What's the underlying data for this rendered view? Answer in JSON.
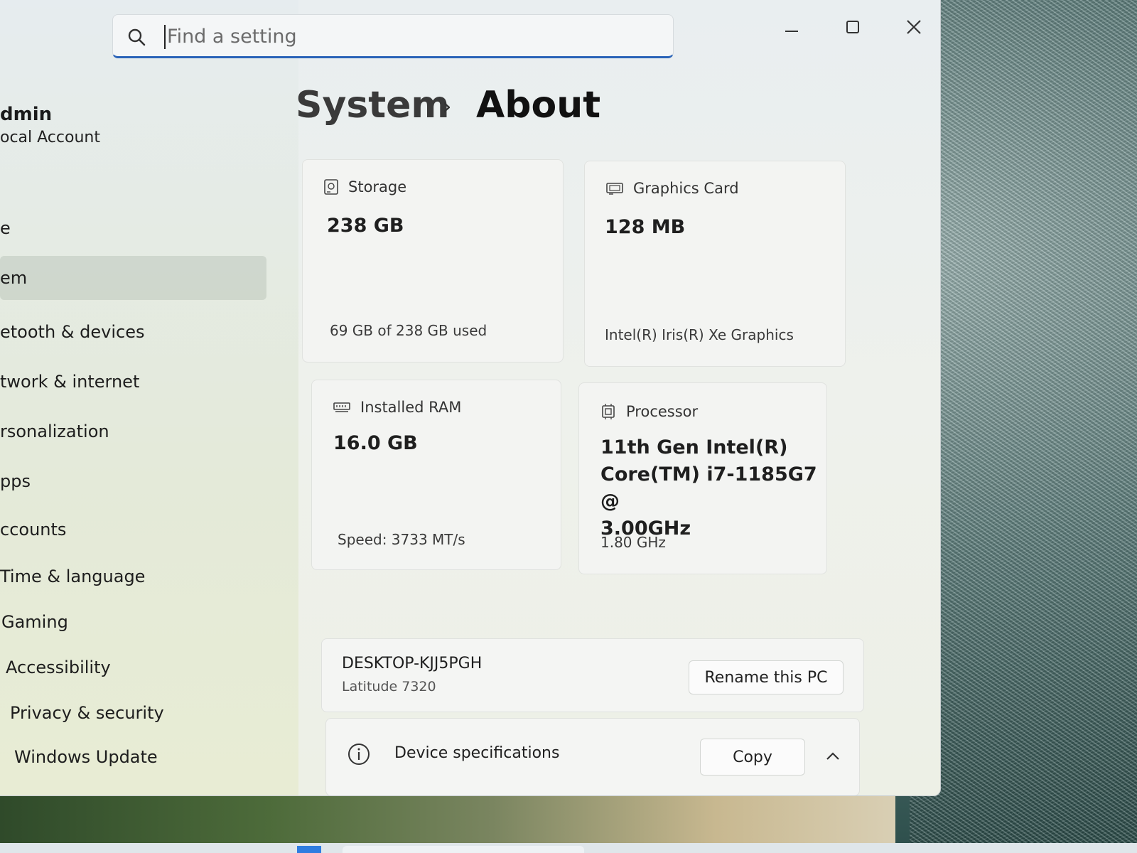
{
  "search": {
    "placeholder": "Find a setting"
  },
  "account": {
    "name": "dmin",
    "type": "ocal Account"
  },
  "sidebar": {
    "items": [
      {
        "label": "e"
      },
      {
        "label": "em"
      },
      {
        "label": "etooth & devices"
      },
      {
        "label": "twork & internet"
      },
      {
        "label": "rsonalization"
      },
      {
        "label": "pps"
      },
      {
        "label": "ccounts"
      },
      {
        "label": "Time & language"
      },
      {
        "label": "Gaming"
      },
      {
        "label": "Accessibility"
      },
      {
        "label": "Privacy & security"
      },
      {
        "label": "Windows Update"
      }
    ]
  },
  "breadcrumb": {
    "parent": "System",
    "separator": "›",
    "current": "About"
  },
  "specs": {
    "storage": {
      "label": "Storage",
      "value": "238 GB",
      "detail": "69 GB of 238 GB used",
      "icon": "storage-icon"
    },
    "graphics": {
      "label": "Graphics Card",
      "value": "128 MB",
      "detail": "Intel(R) Iris(R) Xe Graphics",
      "icon": "graphics-card-icon"
    },
    "ram": {
      "label": "Installed RAM",
      "value": "16.0 GB",
      "detail": "Speed: 3733 MT/s",
      "icon": "ram-icon"
    },
    "processor": {
      "label": "Processor",
      "value_lines": [
        "11th Gen Intel(R)",
        "Core(TM) i7-1185G7 @",
        "3.00GHz"
      ],
      "detail": "1.80 GHz",
      "icon": "processor-icon"
    }
  },
  "device": {
    "name": "DESKTOP-KJJ5PGH",
    "model": "Latitude 7320",
    "rename_label": "Rename this PC"
  },
  "device_specs": {
    "title": "Device specifications",
    "copy_label": "Copy"
  },
  "colors": {
    "accent": "#2a63b8"
  }
}
